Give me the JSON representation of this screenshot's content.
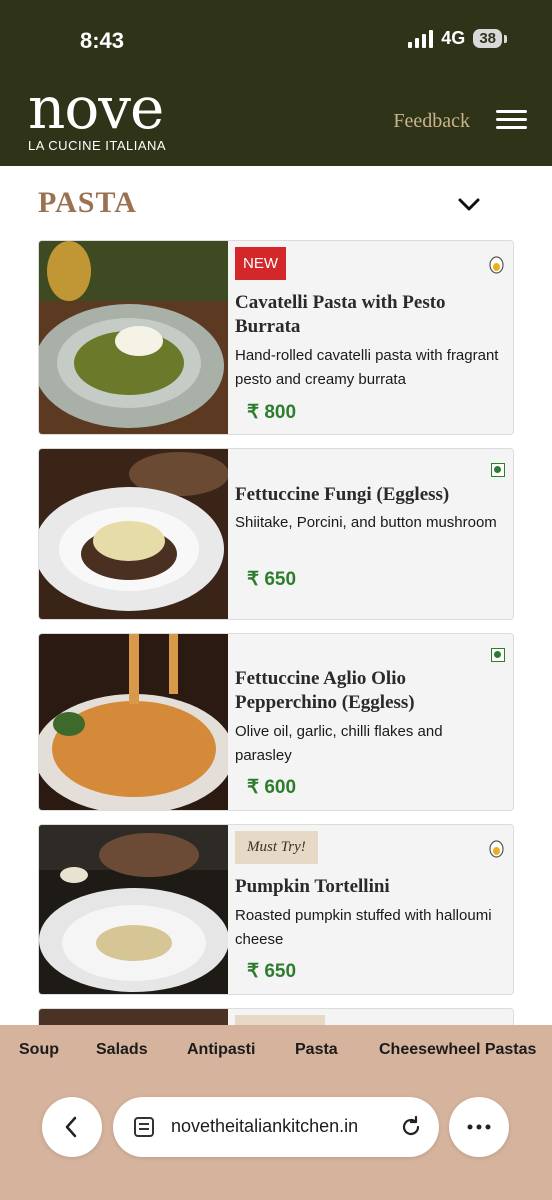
{
  "status_bar": {
    "time": "8:43",
    "network": "4G",
    "battery": "38"
  },
  "header": {
    "logo_word": "nove",
    "logo_sub": "LA CUCINE ITALIANA",
    "feedback_label": "Feedback"
  },
  "section": {
    "title": "PASTA"
  },
  "items": [
    {
      "badge": "NEW",
      "name": "Cavatelli Pasta with Pesto Burrata",
      "description": "Hand-rolled cavatelli pasta with fragrant pesto and creamy burrata",
      "price": "₹ 800",
      "diet_icon": "egg-icon"
    },
    {
      "badge": "",
      "name": "Fettuccine Fungi (Eggless)",
      "description": "Shiitake, Porcini, and button mushroom",
      "price": "₹ 650",
      "diet_icon": "veg-icon"
    },
    {
      "badge": "",
      "name": "Fettuccine Aglio Olio Pepperchino (Eggless)",
      "description": "Olive oil, garlic, chilli flakes and parasley",
      "price": "₹ 600",
      "diet_icon": "veg-icon"
    },
    {
      "badge": "Must Try!",
      "name": "Pumpkin Tortellini",
      "description": "Roasted pumpkin stuffed with halloumi cheese",
      "price": "₹ 650",
      "diet_icon": "egg-icon"
    }
  ],
  "categories": [
    "Soup",
    "Salads",
    "Antipasti",
    "Pasta",
    "Cheesewheel Pastas"
  ],
  "browser": {
    "url": "novetheitaliankitchen.in"
  },
  "colors": {
    "header_bg": "#2f3418",
    "accent_brown": "#9a7250",
    "price_green": "#2e7d2e",
    "new_badge": "#d3272a",
    "bottom_bg": "#d5b39d"
  }
}
